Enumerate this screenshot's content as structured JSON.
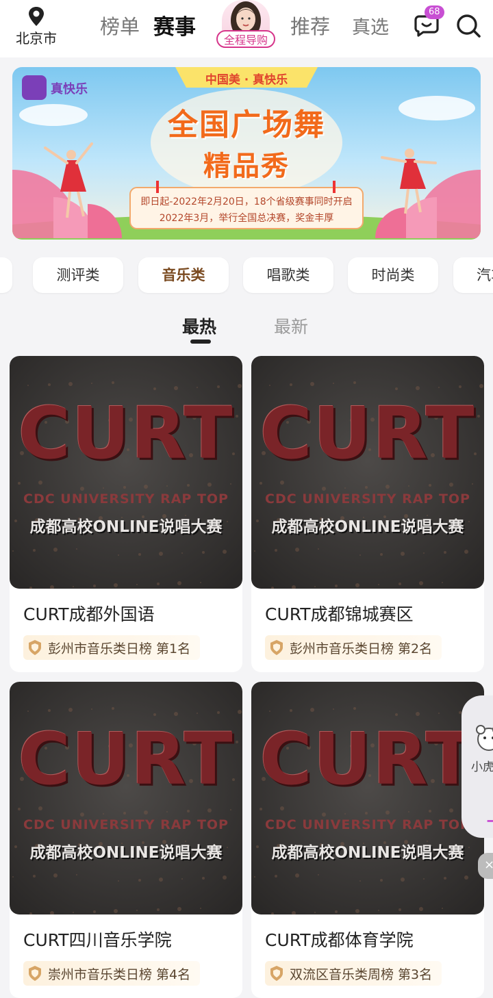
{
  "header": {
    "location": "北京市",
    "tabs": [
      "榜单",
      "赛事"
    ],
    "guide_label": "全程导购",
    "tabs_right": [
      "推荐",
      "真选"
    ],
    "message_count": "68"
  },
  "banner": {
    "app_logo_text": "真快乐",
    "top_ribbon": "中国美 · 真快乐",
    "title_line1": "全国广场舞",
    "title_line2": "精品秀",
    "info_line1": "即日起-2022年2月20日，18个省级赛事同时开启",
    "info_line2": "2022年3月，举行全国总决赛，奖金丰厚"
  },
  "categories": [
    {
      "label": "测评类",
      "active": false
    },
    {
      "label": "音乐类",
      "active": true
    },
    {
      "label": "唱歌类",
      "active": false
    },
    {
      "label": "时尚类",
      "active": false
    },
    {
      "label": "汽车",
      "active": false
    }
  ],
  "sort_tabs": [
    {
      "label": "最热",
      "active": true
    },
    {
      "label": "最新",
      "active": false
    }
  ],
  "poster": {
    "logo": "CURT",
    "subtitle_en": "CDC UNIVERSITY RAP TOP",
    "subtitle_cn": "成都高校ONLINE说唱大赛"
  },
  "cards": [
    {
      "title": "CURT成都外国语",
      "rank": "彭州市音乐类日榜  第1名"
    },
    {
      "title": "CURT成都锦城赛区",
      "rank": "彭州市音乐类日榜  第2名"
    },
    {
      "title": "CURT四川音乐学院",
      "rank": "崇州市音乐类日榜  第4名"
    },
    {
      "title": "CURT成都体育学院",
      "rank": "双流区音乐类周榜  第3名"
    }
  ],
  "float_widget": {
    "label": "小虎"
  },
  "colors": {
    "accent": "#d6358a",
    "badge": "#c84fd3",
    "poster_red": "#7a2428"
  }
}
